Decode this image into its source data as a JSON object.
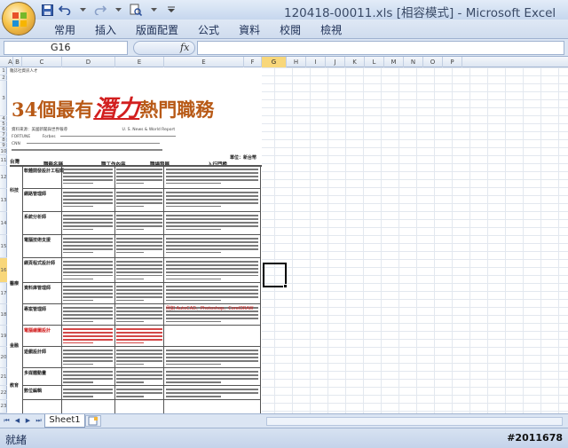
{
  "window": {
    "title": "120418-00011.xls  [相容模式] - Microsoft Excel"
  },
  "ribbon": {
    "tabs": [
      "常用",
      "插入",
      "版面配置",
      "公式",
      "資料",
      "校閱",
      "檢視"
    ]
  },
  "formula_bar": {
    "name_box": "G16",
    "fx_label": "fx",
    "value": ""
  },
  "grid": {
    "columns": [
      "A",
      "B",
      "C",
      "D",
      "E",
      "F",
      "G",
      "H",
      "I",
      "J",
      "K",
      "L",
      "M",
      "N",
      "O",
      "P"
    ],
    "selected_column": "G",
    "rows": [
      "1",
      "2",
      "3",
      "4",
      "5",
      "6",
      "7",
      "8",
      "9",
      "10",
      "11",
      "12",
      "13",
      "14",
      "15",
      "16",
      "17",
      "18",
      "19",
      "20",
      "21",
      "22",
      "23"
    ],
    "selected_row": "16"
  },
  "sheet": {
    "top_label": "雜誌社資訊人才",
    "title_prefix": "34個最有",
    "title_emphasis": "潛力",
    "title_suffix": "熱門職務",
    "source_line_1": "資料來源：美國新聞與世界報導",
    "source_line_1b": "U. S. News & World Report",
    "source_line_2": "FORTUNE",
    "source_line_2b": "Forbes",
    "source_line_3": "CNN",
    "unit_label": "單位：新台幣",
    "col_header_1": "職務名稱",
    "col_header_2": "職工作內容",
    "col_header_3": "職場發展",
    "col_header_4": "入行門檻",
    "categories": [
      "科技",
      "醫療",
      "金融",
      "教育"
    ],
    "jobs": [
      {
        "name": "軟體開發設計工程師",
        "red": false
      },
      {
        "name": "網路管理師",
        "red": false
      },
      {
        "name": "系統分析師",
        "red": false
      },
      {
        "name": "電腦技術支援",
        "red": false
      },
      {
        "name": "網頁程式設計師",
        "red": false
      },
      {
        "name": "資料庫管理師",
        "red": false
      },
      {
        "name": "專案管理師",
        "red": false
      },
      {
        "name": "電腦繪圖設計",
        "red": true
      },
      {
        "name": "遊戲設計師",
        "red": false
      },
      {
        "name": "多媒體動畫",
        "red": false
      },
      {
        "name": "數位編輯",
        "red": false
      }
    ],
    "red_note": "例如 AutoCAD、Photoshop、CorelDRAW"
  },
  "sheet_tabs": {
    "active": "Sheet1"
  },
  "status": {
    "text": "就緒",
    "watermark": "#2011678"
  }
}
